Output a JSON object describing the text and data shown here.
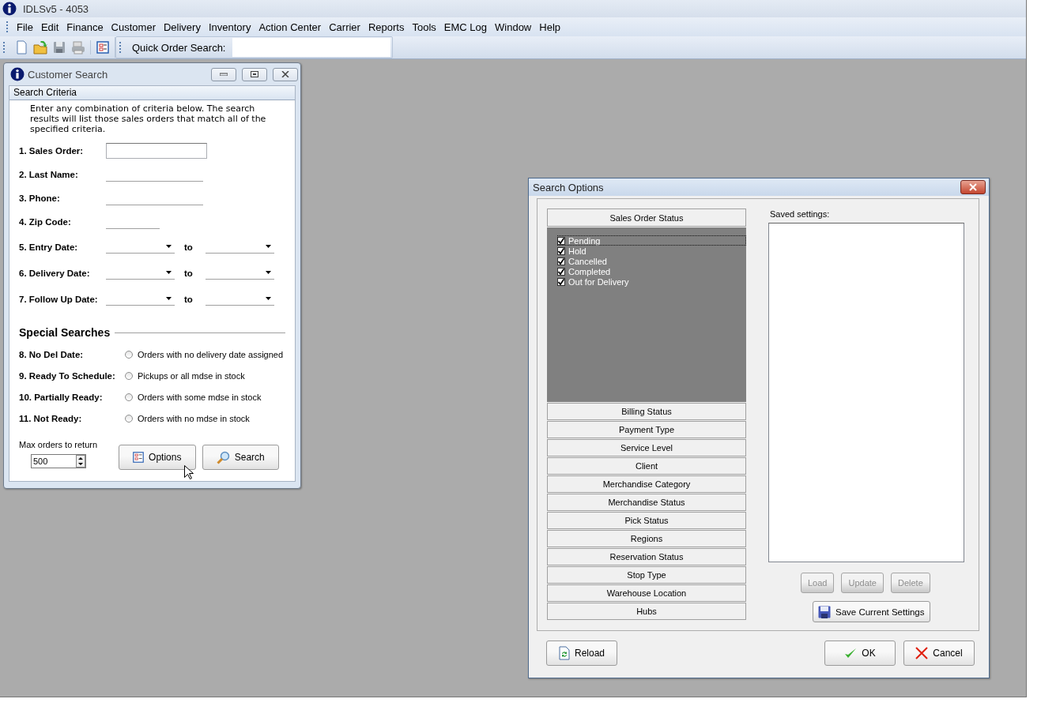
{
  "app": {
    "title": "IDLSv5 - 4053",
    "menu": [
      "File",
      "Edit",
      "Finance",
      "Customer",
      "Delivery",
      "Inventory",
      "Action Center",
      "Carrier",
      "Reports",
      "Tools",
      "EMC Log",
      "Window",
      "Help"
    ],
    "quick_search": {
      "label": "Quick Order Search:"
    }
  },
  "customer_search": {
    "title": "Customer Search",
    "section": "Search Criteria",
    "intro": "Enter any combination of criteria below.  The search results will list those sales orders that match all of the specified criteria.",
    "fields": [
      {
        "kind": "text",
        "label": "1. Sales Order:"
      },
      {
        "kind": "line",
        "label": "2. Last Name:"
      },
      {
        "kind": "line",
        "label": "3. Phone:"
      },
      {
        "kind": "short_line",
        "label": "4. Zip Code:"
      },
      {
        "kind": "date_range",
        "label": "5. Entry Date:",
        "to": "to"
      },
      {
        "kind": "date_range",
        "label": "6. Delivery Date:",
        "to": "to"
      },
      {
        "kind": "date_range",
        "label": "7. Follow Up Date:",
        "to": "to"
      }
    ],
    "special_title": "Special Searches",
    "special": [
      {
        "label": "8. No Del Date:",
        "option": "Orders with no delivery date assigned",
        "selected": false
      },
      {
        "label": "9. Ready To Schedule:",
        "option": "Pickups or all mdse in stock",
        "selected": false
      },
      {
        "label": "10. Partially Ready:",
        "option": "Orders with some mdse in stock",
        "selected": false
      },
      {
        "label": "11. Not Ready:",
        "option": "Orders with no mdse in stock",
        "selected": false
      }
    ],
    "max_label": "Max orders to return",
    "max_value": "500",
    "buttons": [
      {
        "kind": "options",
        "label": "Options"
      },
      {
        "kind": "search",
        "label": "Search"
      }
    ]
  },
  "search_options": {
    "title": "Search Options",
    "groups": [
      {
        "title": "Sales Order Status",
        "expanded": true,
        "items": [
          {
            "label": "Pending",
            "checked": true,
            "focused": true
          },
          {
            "label": "Hold",
            "checked": true,
            "focused": false
          },
          {
            "label": "Cancelled",
            "checked": true,
            "focused": false
          },
          {
            "label": "Completed",
            "checked": true,
            "focused": false
          },
          {
            "label": "Out for Delivery",
            "checked": true,
            "focused": false
          }
        ]
      },
      {
        "title": "Billing Status",
        "expanded": false
      },
      {
        "title": "Payment Type",
        "expanded": false
      },
      {
        "title": "Service Level",
        "expanded": false
      },
      {
        "title": "Client",
        "expanded": false
      },
      {
        "title": "Merchandise Category",
        "expanded": false
      },
      {
        "title": "Merchandise Status",
        "expanded": false
      },
      {
        "title": "Pick Status",
        "expanded": false
      },
      {
        "title": "Regions",
        "expanded": false
      },
      {
        "title": "Reservation Status",
        "expanded": false
      },
      {
        "title": "Stop Type",
        "expanded": false
      },
      {
        "title": "Warehouse Location",
        "expanded": false
      },
      {
        "title": "Hubs",
        "expanded": false
      }
    ],
    "saved_label": "Saved settings:",
    "actions": [
      {
        "label": "Load",
        "disabled": true
      },
      {
        "label": "Update",
        "disabled": true
      },
      {
        "label": "Delete",
        "disabled": true
      }
    ],
    "save_button": {
      "label": "Save Current Settings",
      "disabled": false
    },
    "footer": [
      {
        "kind": "reload",
        "label": "Reload"
      },
      {
        "kind": "ok",
        "label": "OK"
      },
      {
        "kind": "cancel",
        "label": "Cancel"
      }
    ]
  }
}
